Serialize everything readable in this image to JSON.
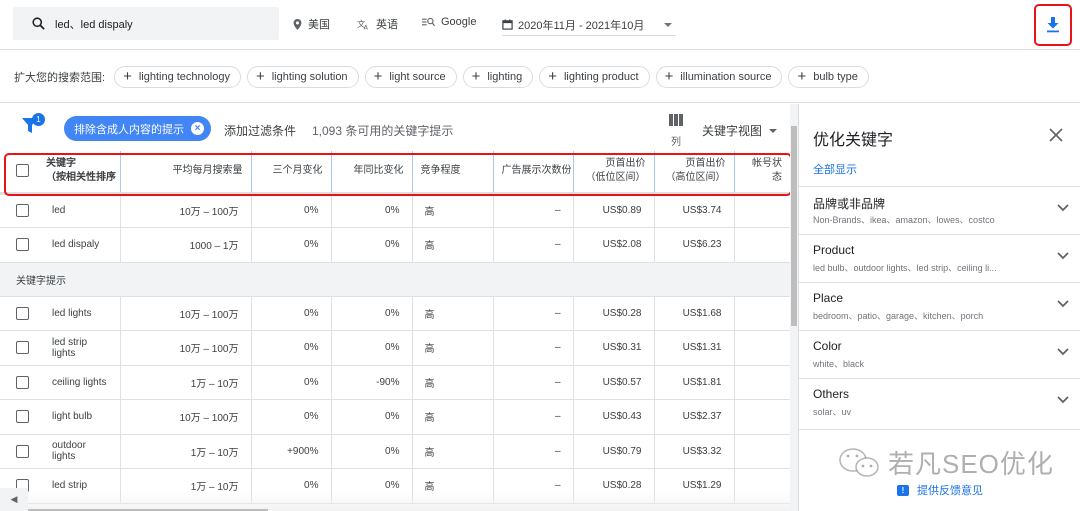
{
  "topbar": {
    "search_value": "led、led dispaly",
    "location": "美国",
    "language": "英语",
    "search_network": "Google",
    "date_range": "2020年11月 - 2021年10月",
    "download_icon": "download-icon"
  },
  "expand": {
    "label": "扩大您的搜索范围:",
    "chips": [
      "lighting technology",
      "lighting solution",
      "light source",
      "lighting",
      "lighting product",
      "illumination source",
      "bulb type"
    ]
  },
  "filters": {
    "badge_count": "1",
    "active_filter": "排除含成人内容的提示",
    "add_filter": "添加过滤条件",
    "count_text": "1,093 条可用的关键字提示",
    "columns_label": "列",
    "view_label": "关键字视图"
  },
  "table": {
    "headers": {
      "keyword_line1": "关键字",
      "keyword_line2": "（按相关性排序",
      "avg_monthly": "平均每月搜索量",
      "three_month": "三个月变化",
      "yoy": "年同比变化",
      "competition": "竞争程度",
      "ad_impr": "广告展示次数份",
      "bid_low_1": "页首出价",
      "bid_low_2": "（低位区间）",
      "bid_high_1": "页首出价",
      "bid_high_2": "（高位区间）",
      "account_status": "帐号状态"
    },
    "provided": [
      {
        "keyword": "led",
        "avg": "10万 – 100万",
        "three": "0%",
        "yoy": "0%",
        "comp": "高",
        "impr": "–",
        "low": "US$0.89",
        "high": "US$3.74"
      },
      {
        "keyword": "led dispaly",
        "avg": "1000 – 1万",
        "three": "0%",
        "yoy": "0%",
        "comp": "高",
        "impr": "–",
        "low": "US$2.08",
        "high": "US$6.23"
      }
    ],
    "section_label": "关键字提示",
    "ideas": [
      {
        "keyword": "led lights",
        "avg": "10万 – 100万",
        "three": "0%",
        "yoy": "0%",
        "comp": "高",
        "impr": "–",
        "low": "US$0.28",
        "high": "US$1.68"
      },
      {
        "keyword": "led strip lights",
        "avg": "10万 – 100万",
        "three": "0%",
        "yoy": "0%",
        "comp": "高",
        "impr": "–",
        "low": "US$0.31",
        "high": "US$1.31"
      },
      {
        "keyword": "ceiling lights",
        "avg": "1万 – 10万",
        "three": "0%",
        "yoy": "-90%",
        "comp": "高",
        "impr": "–",
        "low": "US$0.57",
        "high": "US$1.81"
      },
      {
        "keyword": "light bulb",
        "avg": "10万 – 100万",
        "three": "0%",
        "yoy": "0%",
        "comp": "高",
        "impr": "–",
        "low": "US$0.43",
        "high": "US$2.37"
      },
      {
        "keyword": "outdoor lights",
        "avg": "1万 – 10万",
        "three": "+900%",
        "yoy": "0%",
        "comp": "高",
        "impr": "–",
        "low": "US$0.79",
        "high": "US$3.32"
      },
      {
        "keyword": "led strip",
        "avg": "1万 – 10万",
        "three": "0%",
        "yoy": "0%",
        "comp": "高",
        "impr": "–",
        "low": "US$0.28",
        "high": "US$1.29"
      }
    ]
  },
  "panel": {
    "title": "优化关键字",
    "show_all": "全部显示",
    "facets": [
      {
        "title": "品牌或非品牌",
        "sub": "Non-Brands、ikea、amazon、lowes、costco"
      },
      {
        "title": "Product",
        "sub": "led bulb、outdoor lights、led strip、ceiling li..."
      },
      {
        "title": "Place",
        "sub": "bedroom、patio、garage、kitchen、porch"
      },
      {
        "title": "Color",
        "sub": "white、black"
      },
      {
        "title": "Others",
        "sub": "solar、uv"
      }
    ],
    "feedback": "提供反馈意见"
  },
  "watermark": "若凡SEO优化",
  "colors": {
    "accent": "#1a73e8",
    "chip_blue": "#4285f4",
    "highlight_red": "#e8131a"
  }
}
